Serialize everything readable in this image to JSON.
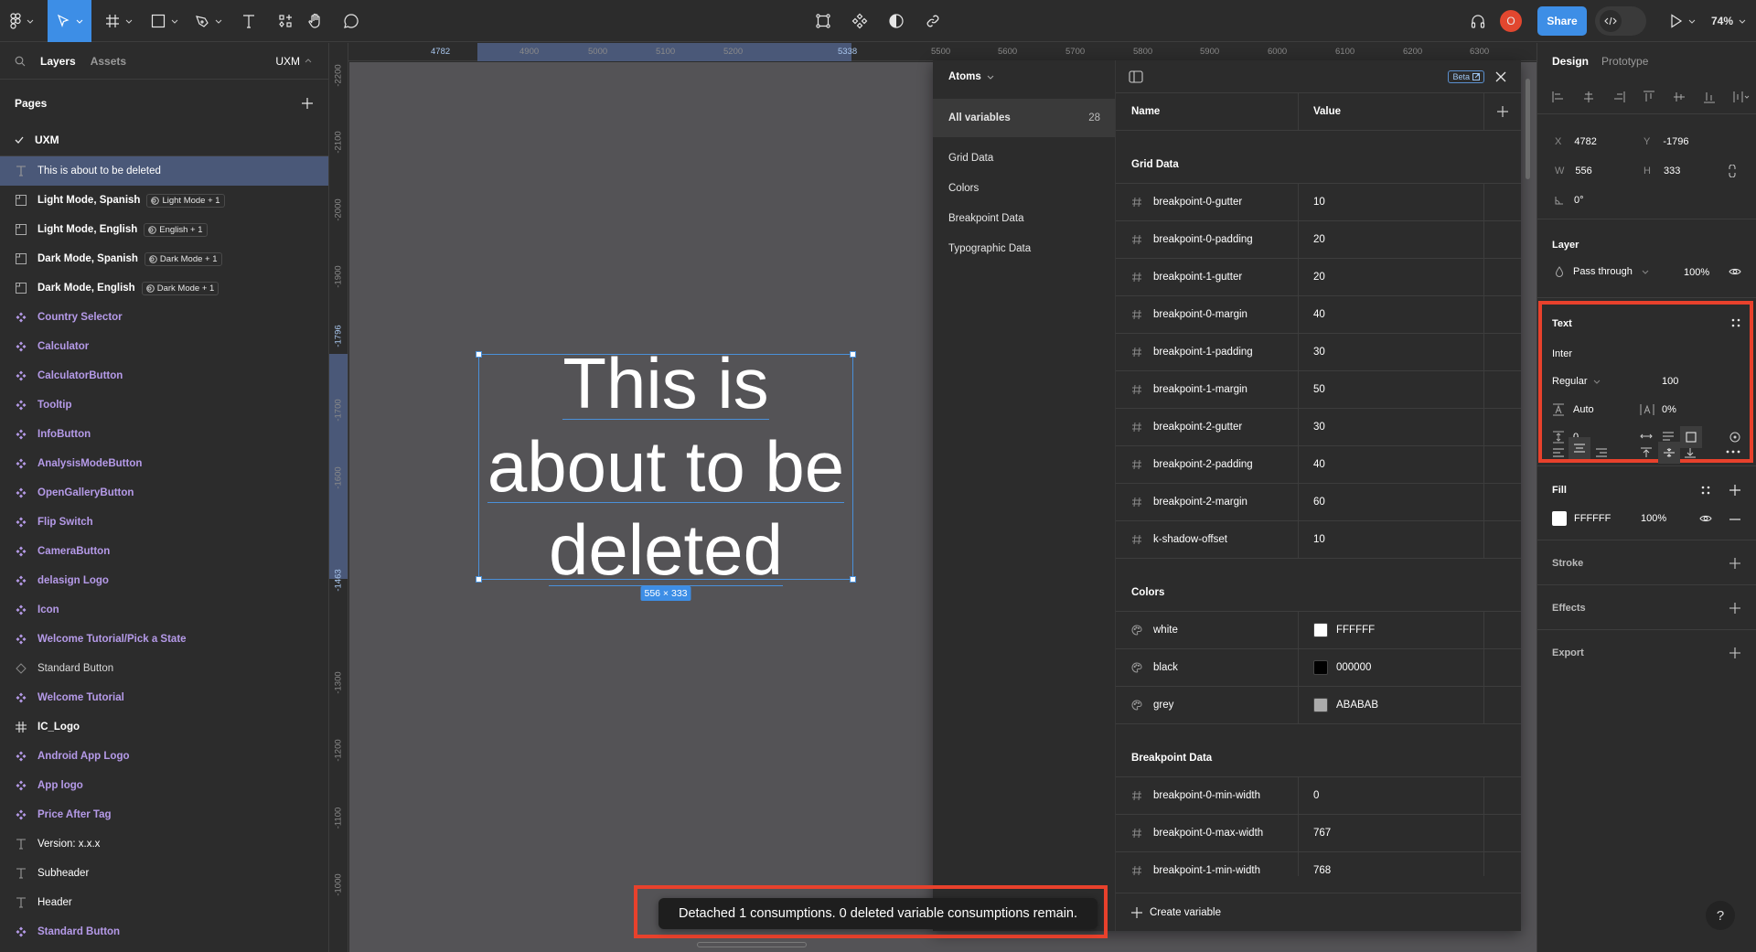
{
  "toolbar": {
    "tools": [
      "main-menu",
      "move",
      "frame",
      "shape",
      "pen",
      "text",
      "resources",
      "hand",
      "comment"
    ],
    "center_tools": [
      "edit-object",
      "components",
      "theme",
      "link"
    ],
    "avatar_initial": "O",
    "avatar_color": "#e2472f",
    "share_label": "Share",
    "zoom_label": "74%",
    "accent_color": "#3d8ee6"
  },
  "left_panel": {
    "tabs": {
      "layers": "Layers",
      "assets": "Assets"
    },
    "page_selector": "UXM",
    "pages_title": "Pages",
    "pages": [
      {
        "label": "UXM",
        "current": true
      }
    ],
    "layers": [
      {
        "name": "This is about to be deleted",
        "type": "text",
        "selected": true
      },
      {
        "name": "Light Mode, Spanish",
        "type": "section",
        "badge": "Light Mode + 1"
      },
      {
        "name": "Light Mode, English",
        "type": "section",
        "badge": "English + 1"
      },
      {
        "name": "Dark Mode, Spanish",
        "type": "section",
        "badge": "Dark Mode + 1"
      },
      {
        "name": "Dark Mode, English",
        "type": "section",
        "badge": "Dark Mode + 1"
      },
      {
        "name": "Country Selector",
        "type": "component"
      },
      {
        "name": "Calculator",
        "type": "component"
      },
      {
        "name": "CalculatorButton",
        "type": "component"
      },
      {
        "name": "Tooltip",
        "type": "component"
      },
      {
        "name": "InfoButton",
        "type": "component"
      },
      {
        "name": "AnalysisModeButton",
        "type": "component"
      },
      {
        "name": "OpenGalleryButton",
        "type": "component"
      },
      {
        "name": "Flip Switch",
        "type": "component"
      },
      {
        "name": "CameraButton",
        "type": "component"
      },
      {
        "name": "delasign Logo",
        "type": "component"
      },
      {
        "name": "Icon",
        "type": "component"
      },
      {
        "name": "Welcome Tutorial/Pick a State",
        "type": "component"
      },
      {
        "name": "Standard Button",
        "type": "instance"
      },
      {
        "name": "Welcome Tutorial",
        "type": "component"
      },
      {
        "name": "IC_Logo",
        "type": "frame"
      },
      {
        "name": "Android App Logo",
        "type": "component"
      },
      {
        "name": "App logo",
        "type": "component"
      },
      {
        "name": "Price After Tag",
        "type": "component"
      },
      {
        "name": "Version: x.x.x",
        "type": "text"
      },
      {
        "name": "Subheader",
        "type": "text"
      },
      {
        "name": "Header",
        "type": "text"
      },
      {
        "name": "Standard Button",
        "type": "component"
      }
    ]
  },
  "rulers": {
    "horizontal": [
      "4782",
      "4900",
      "5000",
      "5100",
      "5200",
      "5338",
      "5500",
      "5600",
      "5700",
      "5800",
      "5900",
      "6000",
      "6100",
      "6200",
      "6300"
    ],
    "vertical": [
      "-2200",
      "-2100",
      "-2000",
      "-1900",
      "-1796",
      "-1700",
      "-1600",
      "-1463",
      "-1300",
      "-1200",
      "-1100",
      "-1000"
    ]
  },
  "canvas": {
    "text_content": "This is about to be deleted",
    "lines": [
      "This is",
      "about to be",
      "deleted"
    ],
    "size_label": "556 × 333"
  },
  "variables_modal": {
    "collection": "Atoms",
    "beta_label": "Beta",
    "groups_nav": [
      {
        "label": "All variables",
        "count": "28",
        "selected": true
      },
      {
        "label": "Grid Data"
      },
      {
        "label": "Colors"
      },
      {
        "label": "Breakpoint Data"
      },
      {
        "label": "Typographic Data"
      }
    ],
    "columns": {
      "name": "Name",
      "value": "Value"
    },
    "groups": [
      {
        "title": "Grid Data",
        "rows": [
          {
            "name": "breakpoint-0-gutter",
            "value": "10",
            "kind": "number"
          },
          {
            "name": "breakpoint-0-padding",
            "value": "20",
            "kind": "number"
          },
          {
            "name": "breakpoint-1-gutter",
            "value": "20",
            "kind": "number"
          },
          {
            "name": "breakpoint-0-margin",
            "value": "40",
            "kind": "number"
          },
          {
            "name": "breakpoint-1-padding",
            "value": "30",
            "kind": "number"
          },
          {
            "name": "breakpoint-1-margin",
            "value": "50",
            "kind": "number"
          },
          {
            "name": "breakpoint-2-gutter",
            "value": "30",
            "kind": "number"
          },
          {
            "name": "breakpoint-2-padding",
            "value": "40",
            "kind": "number"
          },
          {
            "name": "breakpoint-2-margin",
            "value": "60",
            "kind": "number"
          },
          {
            "name": "k-shadow-offset",
            "value": "10",
            "kind": "number"
          }
        ]
      },
      {
        "title": "Colors",
        "rows": [
          {
            "name": "white",
            "value": "FFFFFF",
            "kind": "color",
            "color": "#FFFFFF"
          },
          {
            "name": "black",
            "value": "000000",
            "kind": "color",
            "color": "#000000"
          },
          {
            "name": "grey",
            "value": "ABABAB",
            "kind": "color",
            "color": "#ABABAB"
          }
        ]
      },
      {
        "title": "Breakpoint Data",
        "rows": [
          {
            "name": "breakpoint-0-min-width",
            "value": "0",
            "kind": "number"
          },
          {
            "name": "breakpoint-0-max-width",
            "value": "767",
            "kind": "number"
          },
          {
            "name": "breakpoint-1-min-width",
            "value": "768",
            "kind": "number"
          }
        ]
      }
    ],
    "create_label": "Create variable"
  },
  "right_panel": {
    "tabs": {
      "design": "Design",
      "prototype": "Prototype"
    },
    "position": {
      "x_label": "X",
      "x": "4782",
      "y_label": "Y",
      "y": "-1796",
      "w_label": "W",
      "w": "556",
      "h_label": "H",
      "h": "333",
      "rotation": "0°"
    },
    "layer": {
      "title": "Layer",
      "blend": "Pass through",
      "opacity": "100%"
    },
    "text": {
      "title": "Text",
      "font": "Inter",
      "weight": "Regular",
      "size": "100",
      "line_height": "Auto",
      "letter_spacing": "0%",
      "paragraph_spacing": "0"
    },
    "fill": {
      "title": "Fill",
      "hex": "FFFFFF",
      "opacity": "100%",
      "color": "#FFFFFF"
    },
    "stroke": {
      "title": "Stroke"
    },
    "effects": {
      "title": "Effects"
    },
    "export": {
      "title": "Export"
    }
  },
  "toast": {
    "message": "Detached 1 consumptions. 0 deleted variable consumptions remain."
  },
  "highlight_color": "#e8412c",
  "help_label": "?"
}
